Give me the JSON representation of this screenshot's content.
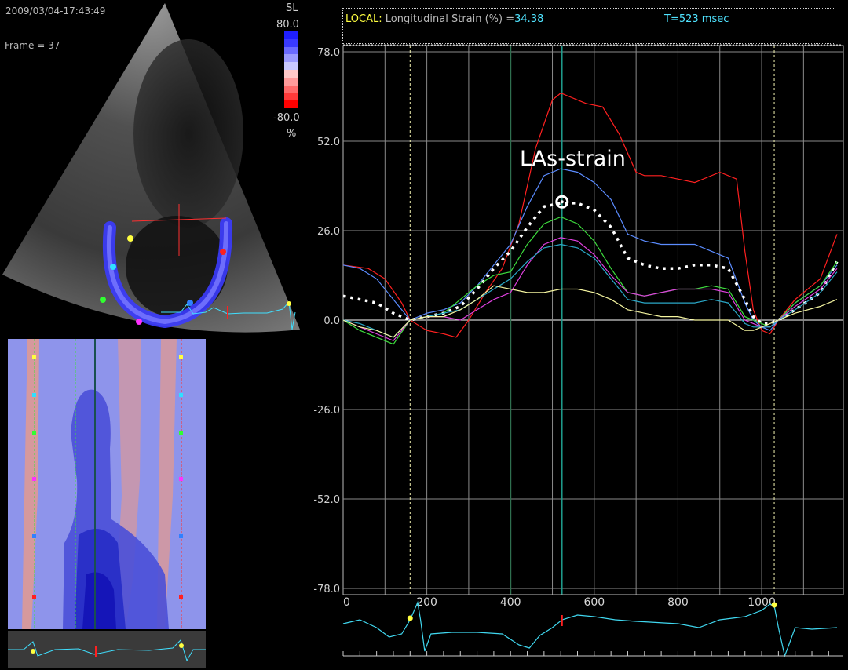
{
  "echo": {
    "timestamp": "2009/03/04-17:43:49",
    "frame": "Frame = 37",
    "scale_label": "SL",
    "scale_max": "80.0",
    "scale_min": "-80.0",
    "scale_unit": "%",
    "colors": [
      "#1f1fff",
      "#3a3aff",
      "#6a6aff",
      "#9a9aff",
      "#c8c8ff",
      "#ffc8c8",
      "#ff9a9a",
      "#ff6a6a",
      "#ff3a3a",
      "#ff0000"
    ]
  },
  "header": {
    "local_label": "LOCAL:",
    "metric_label": "Longitudinal Strain (%) =",
    "metric_value": "34.38",
    "time_label": "T=523 msec"
  },
  "annotation": {
    "text": "LAs-strain"
  },
  "chart_data": {
    "type": "line",
    "xlim": [
      0,
      1180
    ],
    "ylim": [
      -78,
      78
    ],
    "xticks": [
      0,
      200,
      400,
      600,
      800,
      1000
    ],
    "xtick_labels": [
      "0",
      "200",
      "400",
      "600",
      "800",
      "1000"
    ],
    "yticks": [
      78,
      52,
      26,
      0,
      -26,
      -52,
      -78
    ],
    "ytick_labels": [
      "78.0",
      "52.0",
      "26.0",
      "0.0",
      "-26.0",
      "-52.0",
      "-78.0"
    ],
    "grid": true,
    "markers": [
      {
        "x": 160,
        "style": "dotted"
      },
      {
        "x": 400,
        "style": "solid-green"
      },
      {
        "x": 523,
        "style": "solid-teal"
      },
      {
        "x": 1030,
        "style": "dotted"
      }
    ],
    "series": [
      {
        "color": "#ff2020",
        "x": [
          0,
          60,
          100,
          140,
          160,
          200,
          240,
          270,
          300,
          340,
          380,
          420,
          460,
          500,
          520,
          540,
          580,
          620,
          660,
          700,
          720,
          760,
          800,
          840,
          900,
          940,
          960,
          980,
          1000,
          1020,
          1040,
          1080,
          1140,
          1180
        ],
        "y": [
          16,
          15,
          12,
          5,
          0,
          -3,
          -4,
          -5,
          0,
          8,
          15,
          28,
          50,
          64,
          66,
          65,
          63,
          62,
          54,
          43,
          42,
          42,
          41,
          40,
          43,
          41,
          20,
          3,
          -3,
          -4,
          0,
          6,
          12,
          25
        ]
      },
      {
        "color": "#5b8cff",
        "x": [
          0,
          40,
          80,
          120,
          160,
          200,
          240,
          280,
          320,
          360,
          400,
          440,
          480,
          520,
          560,
          600,
          640,
          680,
          720,
          760,
          800,
          840,
          880,
          920,
          960,
          980,
          1000,
          1020,
          1040,
          1080,
          1140,
          1180
        ],
        "y": [
          16,
          15,
          12,
          6,
          0,
          2,
          3,
          5,
          10,
          16,
          22,
          33,
          42,
          44,
          43,
          40,
          35,
          25,
          23,
          22,
          22,
          22,
          20,
          18,
          5,
          0,
          -2,
          -3,
          0,
          5,
          10,
          16
        ]
      },
      {
        "color": "#ffffff",
        "dashed": true,
        "x": [
          0,
          40,
          80,
          120,
          160,
          200,
          240,
          280,
          320,
          360,
          400,
          440,
          480,
          520,
          560,
          600,
          640,
          680,
          720,
          760,
          800,
          840,
          880,
          920,
          960,
          980,
          1000,
          1020,
          1040,
          1080,
          1140,
          1180
        ],
        "y": [
          7,
          6,
          5,
          2,
          0,
          1,
          2,
          4,
          9,
          15,
          20,
          27,
          33,
          34,
          34,
          32,
          27,
          18,
          16,
          15,
          15,
          16,
          16,
          15,
          6,
          1,
          -1,
          -1,
          0,
          3,
          8,
          17
        ]
      },
      {
        "color": "#3ddc3d",
        "x": [
          0,
          40,
          80,
          120,
          160,
          200,
          240,
          280,
          320,
          360,
          400,
          440,
          480,
          520,
          560,
          600,
          640,
          680,
          720,
          760,
          800,
          840,
          880,
          920,
          960,
          980,
          1000,
          1020,
          1040,
          1080,
          1140,
          1180
        ],
        "y": [
          0,
          -3,
          -5,
          -7,
          0,
          1,
          2,
          6,
          10,
          13,
          14,
          22,
          28,
          30,
          28,
          23,
          15,
          8,
          7,
          8,
          9,
          9,
          10,
          9,
          1,
          0,
          -1,
          -2,
          0,
          5,
          10,
          17
        ]
      },
      {
        "color": "#e040e0",
        "x": [
          0,
          40,
          80,
          120,
          160,
          200,
          240,
          280,
          320,
          360,
          400,
          440,
          480,
          520,
          560,
          600,
          640,
          680,
          720,
          760,
          800,
          840,
          880,
          920,
          960,
          980,
          1000,
          1020,
          1040,
          1080,
          1140,
          1180
        ],
        "y": [
          0,
          -2,
          -4,
          -6,
          0,
          1,
          1,
          0,
          3,
          6,
          8,
          16,
          22,
          24,
          23,
          19,
          13,
          8,
          7,
          8,
          9,
          9,
          9,
          8,
          0,
          -1,
          -2,
          -2,
          0,
          4,
          9,
          15
        ]
      },
      {
        "color": "#2aa8c8",
        "x": [
          0,
          40,
          80,
          120,
          160,
          200,
          240,
          280,
          320,
          360,
          400,
          440,
          480,
          520,
          560,
          600,
          640,
          680,
          720,
          760,
          800,
          840,
          880,
          920,
          960,
          980,
          1000,
          1020,
          1040,
          1080,
          1140,
          1180
        ],
        "y": [
          0,
          -1,
          -3,
          -5,
          0,
          1,
          2,
          3,
          6,
          9,
          12,
          17,
          21,
          22,
          21,
          18,
          12,
          6,
          5,
          5,
          5,
          5,
          6,
          5,
          -1,
          -2,
          -2,
          -2,
          0,
          3,
          8,
          14
        ]
      },
      {
        "color": "#f5f5a0",
        "x": [
          0,
          40,
          80,
          120,
          160,
          200,
          240,
          280,
          320,
          360,
          400,
          440,
          480,
          520,
          560,
          600,
          640,
          680,
          720,
          760,
          800,
          840,
          880,
          920,
          960,
          980,
          1000,
          1020,
          1040,
          1080,
          1140,
          1180
        ],
        "y": [
          0,
          -2,
          -3,
          -5,
          0,
          1,
          1,
          3,
          6,
          10,
          9,
          8,
          8,
          9,
          9,
          8,
          6,
          3,
          2,
          1,
          1,
          0,
          0,
          0,
          -3,
          -3,
          -2,
          -1,
          0,
          2,
          4,
          6
        ]
      }
    ]
  }
}
